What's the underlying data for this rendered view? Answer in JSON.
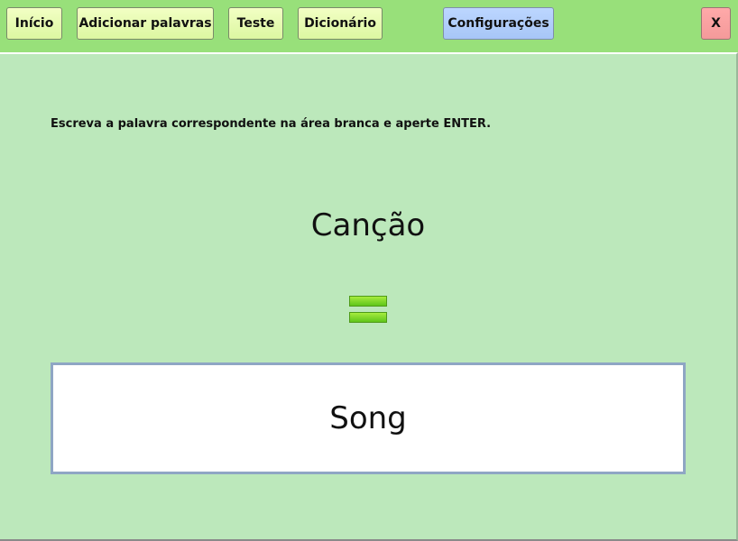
{
  "toolbar": {
    "home_label": "Início",
    "add_words_label": "Adicionar palavras",
    "test_label": "Teste",
    "dictionary_label": "Dicionário",
    "settings_label": "Configurações",
    "close_label": "X"
  },
  "colors": {
    "topbar": "#98e07a",
    "panel": "#bce8bb",
    "nav_button": "#e6fab0",
    "settings_button": "#a7c6f7",
    "close_button": "#f49a9a",
    "equals_icon": "#6fd21f"
  },
  "quiz": {
    "instruction": "Escreva a palavra correspondente na área branca e aperte ENTER.",
    "prompt_word": "Canção",
    "equals_icon": "equals-icon",
    "answer_value": "Song"
  }
}
